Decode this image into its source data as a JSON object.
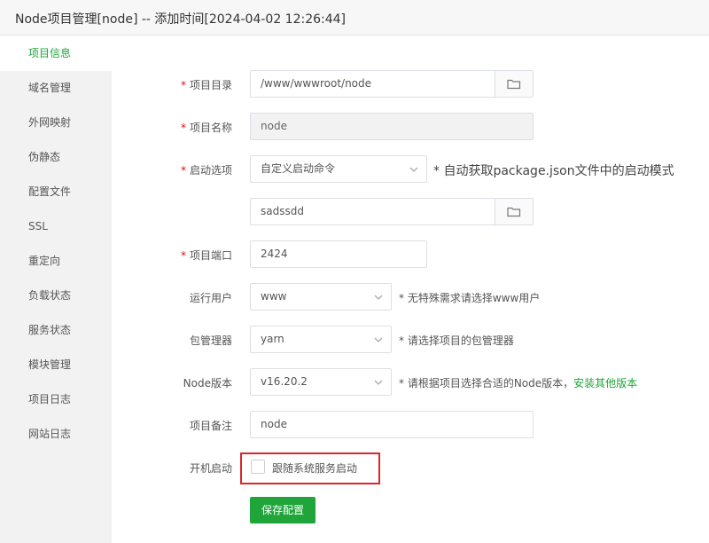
{
  "window": {
    "title": "Node项目管理[node] -- 添加时间[2024-04-02 12:26:44]"
  },
  "sidebar": {
    "items": [
      {
        "label": "项目信息"
      },
      {
        "label": "域名管理"
      },
      {
        "label": "外网映射"
      },
      {
        "label": "伪静态"
      },
      {
        "label": "配置文件"
      },
      {
        "label": "SSL"
      },
      {
        "label": "重定向"
      },
      {
        "label": "负载状态"
      },
      {
        "label": "服务状态"
      },
      {
        "label": "模块管理"
      },
      {
        "label": "项目日志"
      },
      {
        "label": "网站日志"
      }
    ]
  },
  "form": {
    "required_mark": "*",
    "project_dir": {
      "label": "项目目录",
      "value": "/www/wwwroot/node"
    },
    "project_name": {
      "label": "项目名称",
      "value": "node"
    },
    "start_option": {
      "label": "启动选项",
      "value": "自定义启动命令",
      "hint": "* 自动获取package.json文件中的启动模式"
    },
    "start_command": {
      "value": "sadssdd"
    },
    "project_port": {
      "label": "项目端口",
      "value": "2424"
    },
    "run_user": {
      "label": "运行用户",
      "value": "www",
      "hint": "* 无特殊需求请选择www用户"
    },
    "package_manager": {
      "label": "包管理器",
      "value": "yarn",
      "hint": "* 请选择项目的包管理器"
    },
    "node_version": {
      "label": "Node版本",
      "value": "v16.20.2",
      "hint": "* 请根据项目选择合适的Node版本，",
      "link": "安装其他版本"
    },
    "project_note": {
      "label": "项目备注",
      "value": "node"
    },
    "boot_start": {
      "label": "开机启动",
      "checkbox_label": "跟随系统服务启动",
      "checked": false
    },
    "save_label": "保存配置"
  },
  "colors": {
    "accent": "#20a53a",
    "required": "#ef0808",
    "highlight_box": "#d9262a"
  }
}
